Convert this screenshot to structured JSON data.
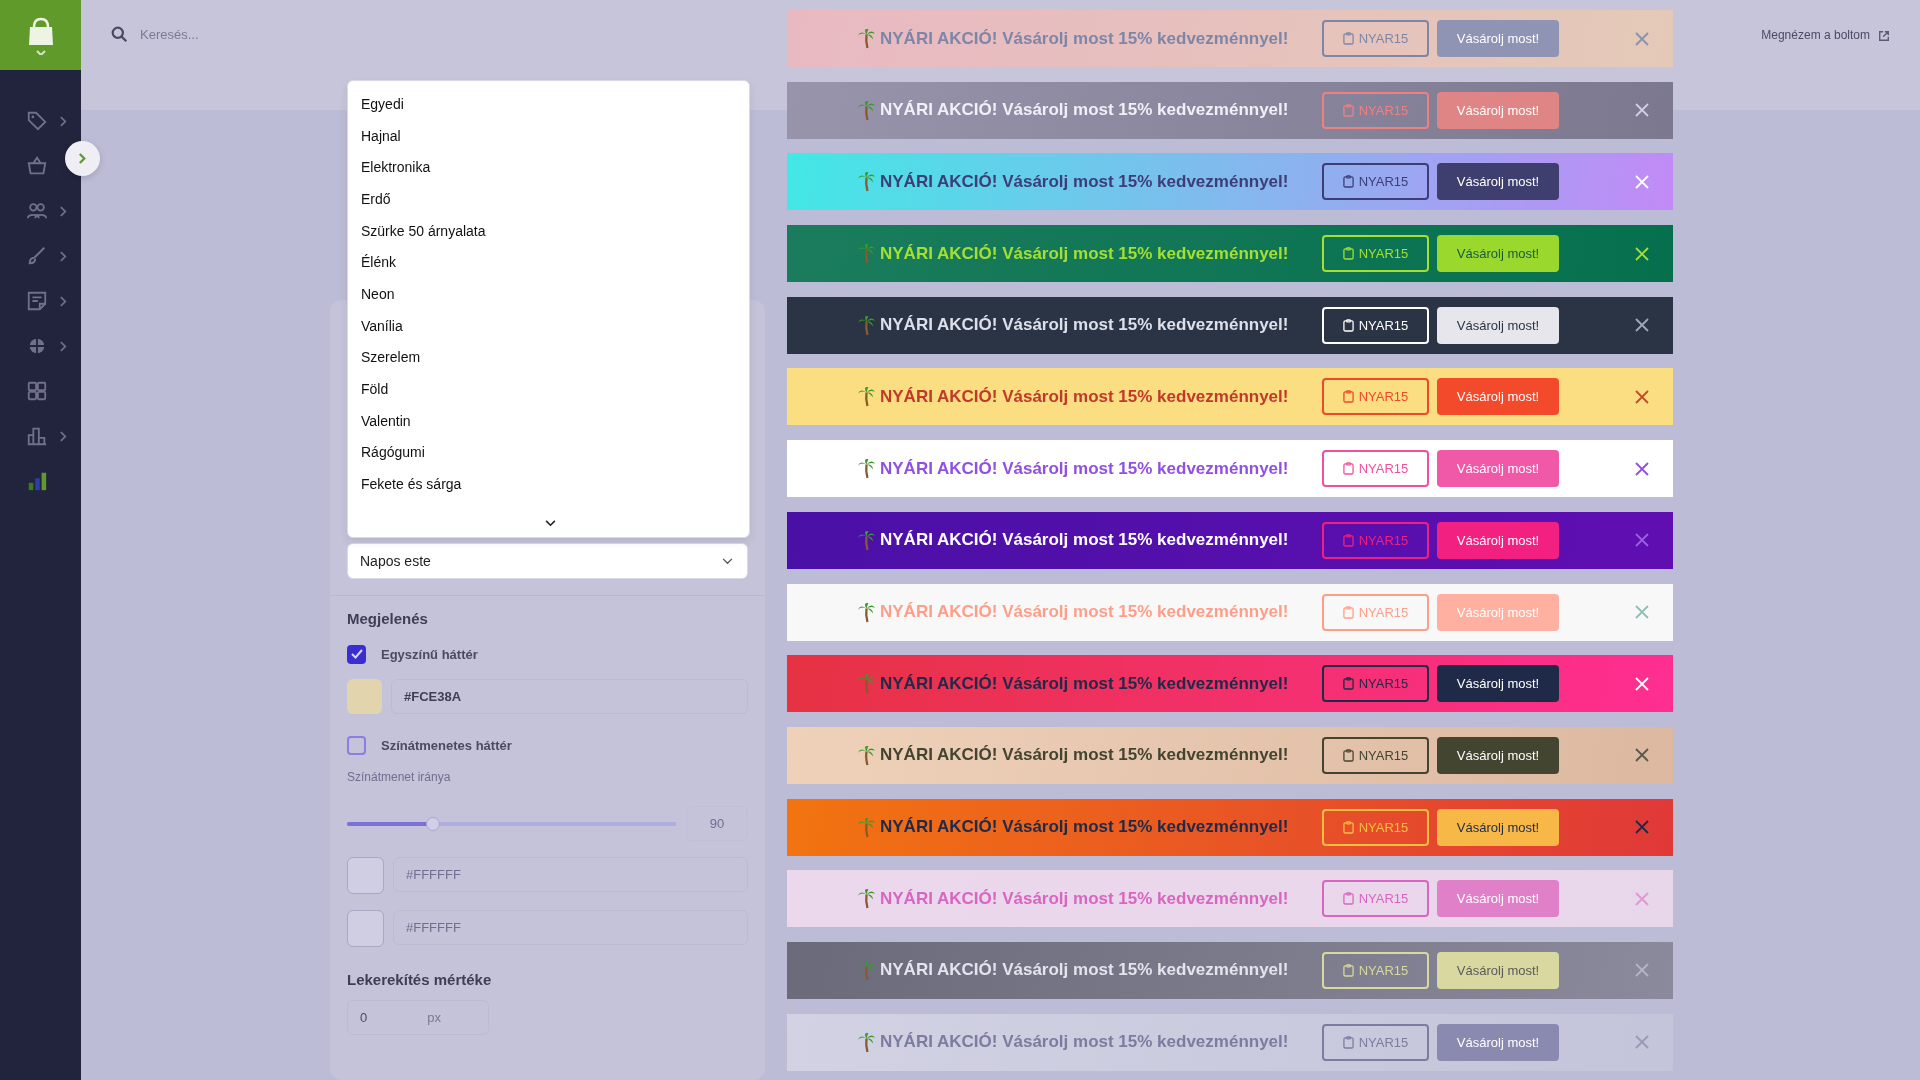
{
  "sidebar": {
    "items": [
      {
        "kind": "tag",
        "submenu": true
      },
      {
        "kind": "basket",
        "submenu": false
      },
      {
        "kind": "users",
        "submenu": true
      },
      {
        "kind": "brush",
        "submenu": true
      },
      {
        "kind": "note",
        "submenu": true
      },
      {
        "kind": "target",
        "submenu": true
      },
      {
        "kind": "grid",
        "submenu": false
      },
      {
        "kind": "chart",
        "submenu": true
      },
      {
        "kind": "stats",
        "submenu": false
      }
    ]
  },
  "search": {
    "placeholder": "Keresés..."
  },
  "store_link": "Megnézem a boltom",
  "theme_dropdown": {
    "options": [
      {
        "label": "Egyedi",
        "selected": false
      },
      {
        "label": "Hajnal",
        "selected": false
      },
      {
        "label": "Elektronika",
        "selected": false
      },
      {
        "label": "Erdő",
        "selected": false
      },
      {
        "label": "Szürke 50 árnyalata",
        "selected": false
      },
      {
        "label": "Élénk",
        "selected": false
      },
      {
        "label": "Neon",
        "selected": false
      },
      {
        "label": "Vanília",
        "selected": false
      },
      {
        "label": "Szerelem",
        "selected": false
      },
      {
        "label": "Föld",
        "selected": false
      },
      {
        "label": "Valentin",
        "selected": false
      },
      {
        "label": "Rágógumi",
        "selected": false
      },
      {
        "label": "Fekete és sárga",
        "selected": false
      }
    ],
    "value": "Napos este"
  },
  "appearance": {
    "title": "Megjelenés",
    "solid_background": {
      "label": "Egyszínű háttér",
      "checked": true
    },
    "solid_color": "#FCE38A",
    "gradient_background": {
      "label": "Színátmenetes háttér",
      "checked": false
    },
    "gradient_direction": {
      "label": "Színátmenet iránya",
      "level": 0.26,
      "value": "90",
      "disabled": true
    },
    "gradient_colors": [
      "#FFFFFF",
      "#FFFFFF"
    ],
    "radius": {
      "label": "Lekerekítés mértéke",
      "value": "0",
      "unit": "px"
    }
  },
  "banners": [
    {
      "kind": "blush",
      "message": "NYÁRI AKCIÓ! Vásárolj most 15% kedvezménnyel!",
      "code": "NYAR15",
      "button": "Vásárolj most!"
    },
    {
      "kind": "dusk",
      "message": "NYÁRI AKCIÓ! Vásárolj most 15% kedvezménnyel!",
      "code": "NYAR15",
      "button": "Vásárolj most!"
    },
    {
      "kind": "ocean",
      "message": "NYÁRI AKCIÓ! Vásárolj most 15% kedvezménnyel!",
      "code": "NYAR15",
      "button": "Vásárolj most!"
    },
    {
      "kind": "forest",
      "message": "NYÁRI AKCIÓ! Vásárolj most 15% kedvezménnyel!",
      "code": "NYAR15",
      "button": "Vásárolj most!"
    },
    {
      "kind": "slate",
      "message": "NYÁRI AKCIÓ! Vásárolj most 15% kedvezménnyel!",
      "code": "NYAR15",
      "button": "Vásárolj most!"
    },
    {
      "kind": "sunny",
      "message": "NYÁRI AKCIÓ! Vásárolj most 15% kedvezménnyel!",
      "code": "NYAR15",
      "button": "Vásárolj most!"
    },
    {
      "kind": "white",
      "message": "NYÁRI AKCIÓ! Vásárolj most 15% kedvezménnyel!",
      "code": "NYAR15",
      "button": "Vásárolj most!"
    },
    {
      "kind": "violet",
      "message": "NYÁRI AKCIÓ! Vásárolj most 15% kedvezménnyel!",
      "code": "NYAR15",
      "button": "Vásárolj most!"
    },
    {
      "kind": "vanilla",
      "message": "NYÁRI AKCIÓ! Vásárolj most 15% kedvezménnyel!",
      "code": "NYAR15",
      "button": "Vásárolj most!"
    },
    {
      "kind": "love",
      "message": "NYÁRI AKCIÓ! Vásárolj most 15% kedvezménnyel!",
      "code": "NYAR15",
      "button": "Vásárolj most!"
    },
    {
      "kind": "earth",
      "message": "NYÁRI AKCIÓ! Vásárolj most 15% kedvezménnyel!",
      "code": "NYAR15",
      "button": "Vásárolj most!"
    },
    {
      "kind": "fire",
      "message": "NYÁRI AKCIÓ! Vásárolj most 15% kedvezménnyel!",
      "code": "NYAR15",
      "button": "Vásárolj most!"
    },
    {
      "kind": "bubblegum",
      "message": "NYÁRI AKCIÓ! Vásárolj most 15% kedvezménnyel!",
      "code": "NYAR15",
      "button": "Vásárolj most!"
    },
    {
      "kind": "grey",
      "message": "NYÁRI AKCIÓ! Vásárolj most 15% kedvezménnyel!",
      "code": "NYAR15",
      "button": "Vásárolj most!"
    },
    {
      "kind": "haze",
      "message": "NYÁRI AKCIÓ! Vásárolj most 15% kedvezménnyel!",
      "code": "NYAR15",
      "button": "Vásárolj most!"
    }
  ]
}
